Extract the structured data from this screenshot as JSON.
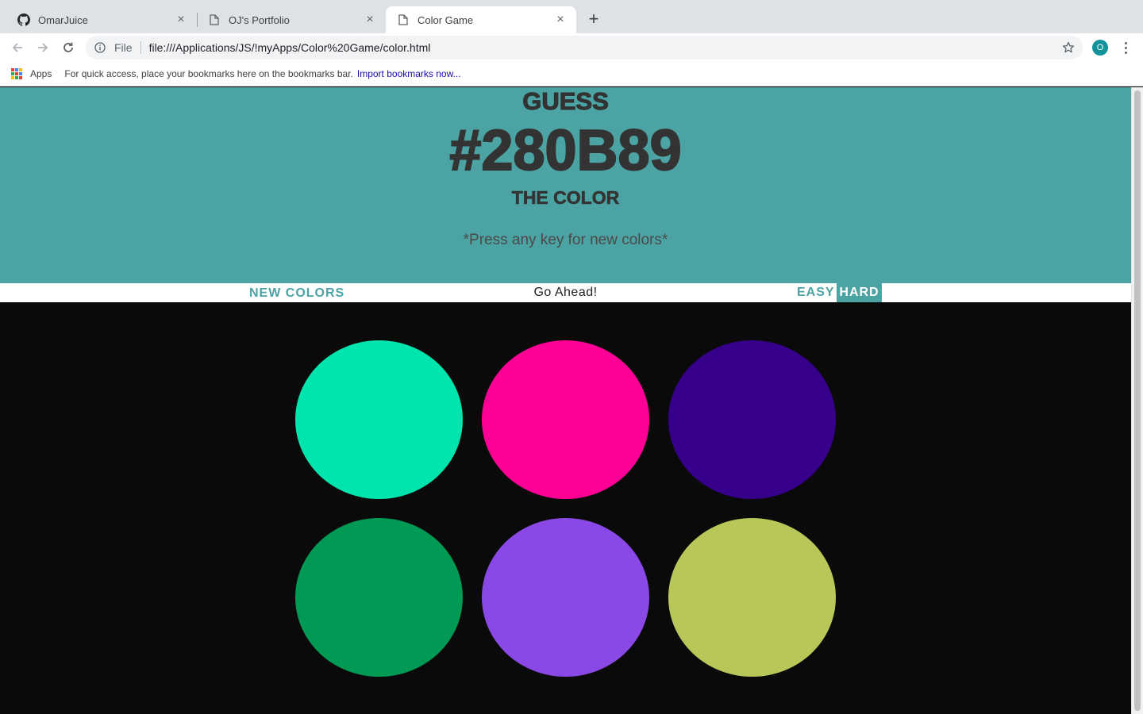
{
  "browser": {
    "tabs": [
      {
        "title": "OmarJuice",
        "icon": "github-icon",
        "active": false
      },
      {
        "title": "OJ's Portfolio",
        "icon": "page-icon",
        "active": false
      },
      {
        "title": "Color Game",
        "icon": "page-icon",
        "active": true
      }
    ],
    "address": {
      "scheme": "File",
      "url": "file:///Applications/JS/!myApps/Color%20Game/color.html"
    },
    "profile_initial": "O",
    "bookmarks": {
      "apps_label": "Apps",
      "hint": "For quick access, place your bookmarks here on the bookmarks bar.",
      "import_link": "Import bookmarks now..."
    }
  },
  "game": {
    "heading_top": "GUESS",
    "target_color": "#280B89",
    "heading_bottom": "THE COLOR",
    "hint": "*Press any key for new colors*",
    "new_colors_label": "NEW COLORS",
    "message": "Go Ahead!",
    "easy_label": "EASY",
    "hard_label": "HARD",
    "selected_mode": "HARD",
    "theme_color": "#4ca3a3",
    "squares": [
      "#00e5ad",
      "#ff0096",
      "#37008a",
      "#009a54",
      "#8a48e6",
      "#b9c759"
    ]
  }
}
